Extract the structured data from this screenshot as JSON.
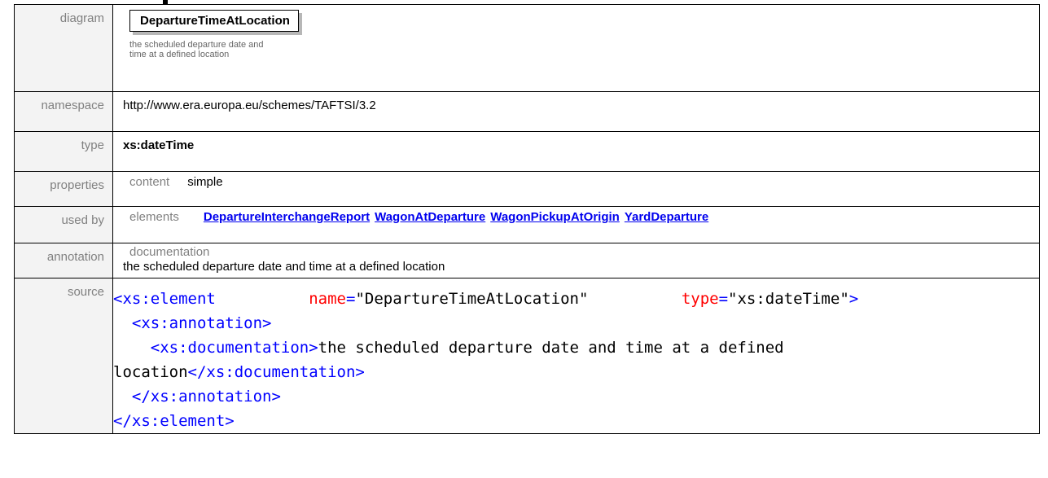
{
  "diagram": {
    "label": "diagram",
    "element_name": "DepartureTimeAtLocation",
    "documentation_line1": "the scheduled departure date and",
    "documentation_line2": "time at a defined location"
  },
  "namespace": {
    "label": "namespace",
    "value": "http://www.era.europa.eu/schemes/TAFTSI/3.2"
  },
  "type": {
    "label": "type",
    "value": "xs:dateTime"
  },
  "properties": {
    "label": "properties",
    "key": "content",
    "value": "simple"
  },
  "used_by": {
    "label": "used by",
    "key": "elements",
    "links": [
      "DepartureInterchangeReport",
      "WagonAtDeparture",
      "WagonPickupAtOrigin",
      "YardDeparture"
    ]
  },
  "annotation": {
    "label": "annotation",
    "key": "documentation",
    "value": "the scheduled departure date and time at a defined location"
  },
  "source": {
    "label": "source",
    "element_open_tag": "<xs:element",
    "name_attr": "name",
    "name_value": "\"DepartureTimeAtLocation\"",
    "type_attr": "type",
    "type_value": "\"xs:dateTime\"",
    "annotation_open": "<xs:annotation>",
    "documentation_open": "<xs:documentation>",
    "documentation_text_line1": "the scheduled departure date and time at a defined",
    "documentation_text_line2": "location",
    "documentation_close": "</xs:documentation>",
    "annotation_close": "</xs:annotation>",
    "element_close": "</xs:element>"
  },
  "colors": {
    "label_text": "#808080",
    "label_background": "#f3f3f3",
    "link": "#0000ee",
    "xml_bracket": "#0000ff",
    "xml_tag": "#800000",
    "xml_attr": "#ff0000"
  }
}
